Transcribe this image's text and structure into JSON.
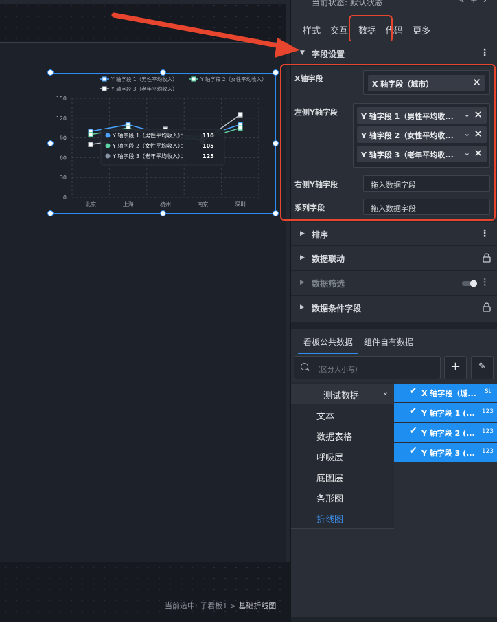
{
  "footer": {
    "prefix": "当前选中: 子看板1 > ",
    "current": "基础折线图"
  },
  "chart_data": {
    "type": "line",
    "categories": [
      "北京",
      "上海",
      "杭州",
      "南京",
      "深圳"
    ],
    "ylim": [
      0,
      150
    ],
    "yticks": [
      "0",
      "30",
      "60",
      "90",
      "120",
      "150"
    ],
    "series": [
      {
        "name": "Y 轴字段 1（男性平均收入）",
        "values": [
          100,
          110,
          95,
          92,
          110
        ],
        "color": "#4aa3ff"
      },
      {
        "name": "Y 轴字段 2（女性平均收入）",
        "values": [
          95,
          105,
          90,
          88,
          105
        ],
        "color": "#5fd3a3"
      },
      {
        "name": "Y 轴字段 3（老年平均收入）",
        "values": [
          80,
          88,
          103,
          85,
          125
        ],
        "color": "#b7bcc7"
      }
    ],
    "tooltip": {
      "rows": [
        {
          "label": "Y 轴字段 1（男性平均收入）：",
          "value": "110",
          "color": "#4aa3ff"
        },
        {
          "label": "Y 轴字段 2（女性平均收入）：",
          "value": "105",
          "color": "#5fd3a3"
        },
        {
          "label": "Y 轴字段 3（老年平均收入）：",
          "value": "125",
          "color": "#8a93a3"
        }
      ]
    },
    "grid": true,
    "legend_position": "top"
  },
  "panel": {
    "state_text": "当前状态: 默认状态",
    "tabs": [
      "样式",
      "交互",
      "数据",
      "代码",
      "更多"
    ],
    "active_tab": "数据",
    "sections": {
      "fields": "字段设置",
      "sort": "排序",
      "linkage": "数据联动",
      "filter": "数据筛选",
      "conditional": "数据条件字段"
    },
    "fields": {
      "x_label": "X轴字段",
      "x_chip": "X 轴字段（城市）",
      "left_y_label": "左侧Y轴字段",
      "left_y_chips": [
        "Y 轴字段 1（男性平均收...",
        "Y 轴字段 2（女性平均收...",
        "Y 轴字段 3（老年平均收..."
      ],
      "right_y_label": "右侧Y轴字段",
      "right_y_placeholder": "拖入数据字段",
      "series_label": "系列字段",
      "series_placeholder": "拖入数据字段"
    },
    "data_tabs": [
      "看板公共数据",
      "组件自有数据"
    ],
    "search_placeholder": "（区分大小写）",
    "tree": {
      "parent": "测试数据",
      "items": [
        "文本",
        "数据表格",
        "呼吸层",
        "底图层",
        "条形图",
        "折线图"
      ],
      "active": "折线图"
    },
    "field_list": [
      {
        "label": "X 轴字段（城...",
        "type": "Str"
      },
      {
        "label": "Y 轴字段 1 (...",
        "type": "123"
      },
      {
        "label": "Y 轴字段 2 (...",
        "type": "123"
      },
      {
        "label": "Y 轴字段 3 (...",
        "type": "123"
      }
    ]
  }
}
